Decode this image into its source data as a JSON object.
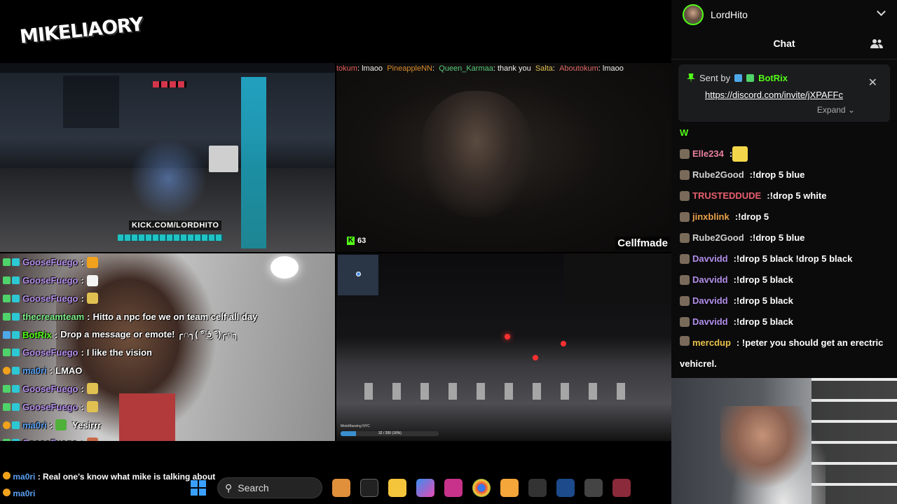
{
  "logo": {
    "text": "MIKELIAORY"
  },
  "top_left": {
    "url_text": "KICK.COM/LORDHITO"
  },
  "top_right": {
    "chat_ticker": [
      {
        "name": "tokum",
        "sep": ":",
        "msg": "lmaoo"
      },
      {
        "name": "PineappleNN",
        "sep": ":",
        "msg": ""
      },
      {
        "name": "Queen_Karmaa",
        "sep": ":",
        "msg": "thank you"
      },
      {
        "name": "Salta",
        "sep": ":",
        "msg": ""
      },
      {
        "name": "Aboutokum",
        "sep": ":",
        "msg": "lmaoo"
      }
    ],
    "viewer_count": "63",
    "handle": "Cellfmade"
  },
  "bottom_left_chat": [
    {
      "name": "GooseFuego",
      "color": "#b992f0",
      "msg": "",
      "emote": "#f0a21c",
      "badge": "green"
    },
    {
      "name": "GooseFuego",
      "color": "#b992f0",
      "msg": "",
      "emote": "#f4f4f4",
      "badge": "green"
    },
    {
      "name": "GooseFuego",
      "color": "#b992f0",
      "msg": "",
      "emote": "#e0c050",
      "badge": "green"
    },
    {
      "name": "thecreamteam",
      "color": "#7ef08a",
      "msg": "Hitto a npc foe we on team celf all day",
      "emote": "",
      "badge": "green"
    },
    {
      "name": "BotRix",
      "color": "#53fc18",
      "msg": "Drop a message or emote! ╭∩╮( ͡° ͜ʖ ͡°)╭∩╮",
      "emote": "",
      "badge": "blue"
    },
    {
      "name": "GooseFuego",
      "color": "#b992f0",
      "msg": "I like the vision",
      "emote": "",
      "badge": "green"
    },
    {
      "name": "ma0ri",
      "color": "#5aa0f0",
      "msg": "LMAO",
      "emote": "",
      "badge": "orange"
    },
    {
      "name": "GooseFuego",
      "color": "#b992f0",
      "msg": "",
      "emote": "#e0c050",
      "badge": "green"
    },
    {
      "name": "GooseFuego",
      "color": "#b992f0",
      "msg": "",
      "emote": "#e0c050",
      "badge": "green"
    },
    {
      "name": "ma0ri",
      "color": "#5aa0f0",
      "msg": "Yesirrr",
      "emote": "#4fb03a",
      "badge": "orange"
    },
    {
      "name": "GooseFuego",
      "color": "#b992f0",
      "msg": "",
      "emote": "#c86a4a",
      "badge": "green"
    },
    {
      "name": "GooseFuego",
      "color": "#b992f0",
      "msg": "",
      "emote": "#c86a4a",
      "badge": "green"
    }
  ],
  "bottom_overlay": {
    "line1": "Real one's know what mike is talking about",
    "line1_name": "ma0ri",
    "line2_name": "ma0ri"
  },
  "dashcam": {
    "label": "MotoMaxxing NYC",
    "progress_text": "32 / 200 (16%)",
    "progress": 0.16
  },
  "taskbar": {
    "search_placeholder": "Search"
  },
  "side_panel": {
    "username": "LordHito",
    "title": "Chat",
    "pinned": {
      "sent_by_label": "Sent by",
      "bot_name": "BotRix",
      "link": "https://discord.com/invite/jXPAFFc",
      "expand_label": "Expand"
    },
    "messages": [
      {
        "user": "W",
        "color": "#53fc18",
        "msg": ""
      },
      {
        "user": "Elle234",
        "color": "#e7809b",
        "msg": ""
      },
      {
        "user": "Rube2Good",
        "color": "#d0d0d0",
        "msg": "!drop 5 blue"
      },
      {
        "user": "TRUSTEDDUDE",
        "color": "#e75f6c",
        "msg": "!drop 5 white"
      },
      {
        "user": "jinxblink",
        "color": "#e8a24a",
        "msg": "!drop 5"
      },
      {
        "user": "Rube2Good",
        "color": "#d0d0d0",
        "msg": "!drop 5 blue"
      },
      {
        "user": "Davvidd",
        "color": "#b08de8",
        "msg": "!drop 5 black !drop 5 black"
      },
      {
        "user": "Davvidd",
        "color": "#b08de8",
        "msg": "!drop 5 black"
      },
      {
        "user": "Davvidd",
        "color": "#b08de8",
        "msg": "!drop 5 black"
      },
      {
        "user": "Davvidd",
        "color": "#b08de8",
        "msg": "!drop 5 black"
      },
      {
        "user": "mercdup",
        "color": "#e8c24a",
        "msg": "!peter you should get an erectric vehicrel."
      }
    ]
  }
}
